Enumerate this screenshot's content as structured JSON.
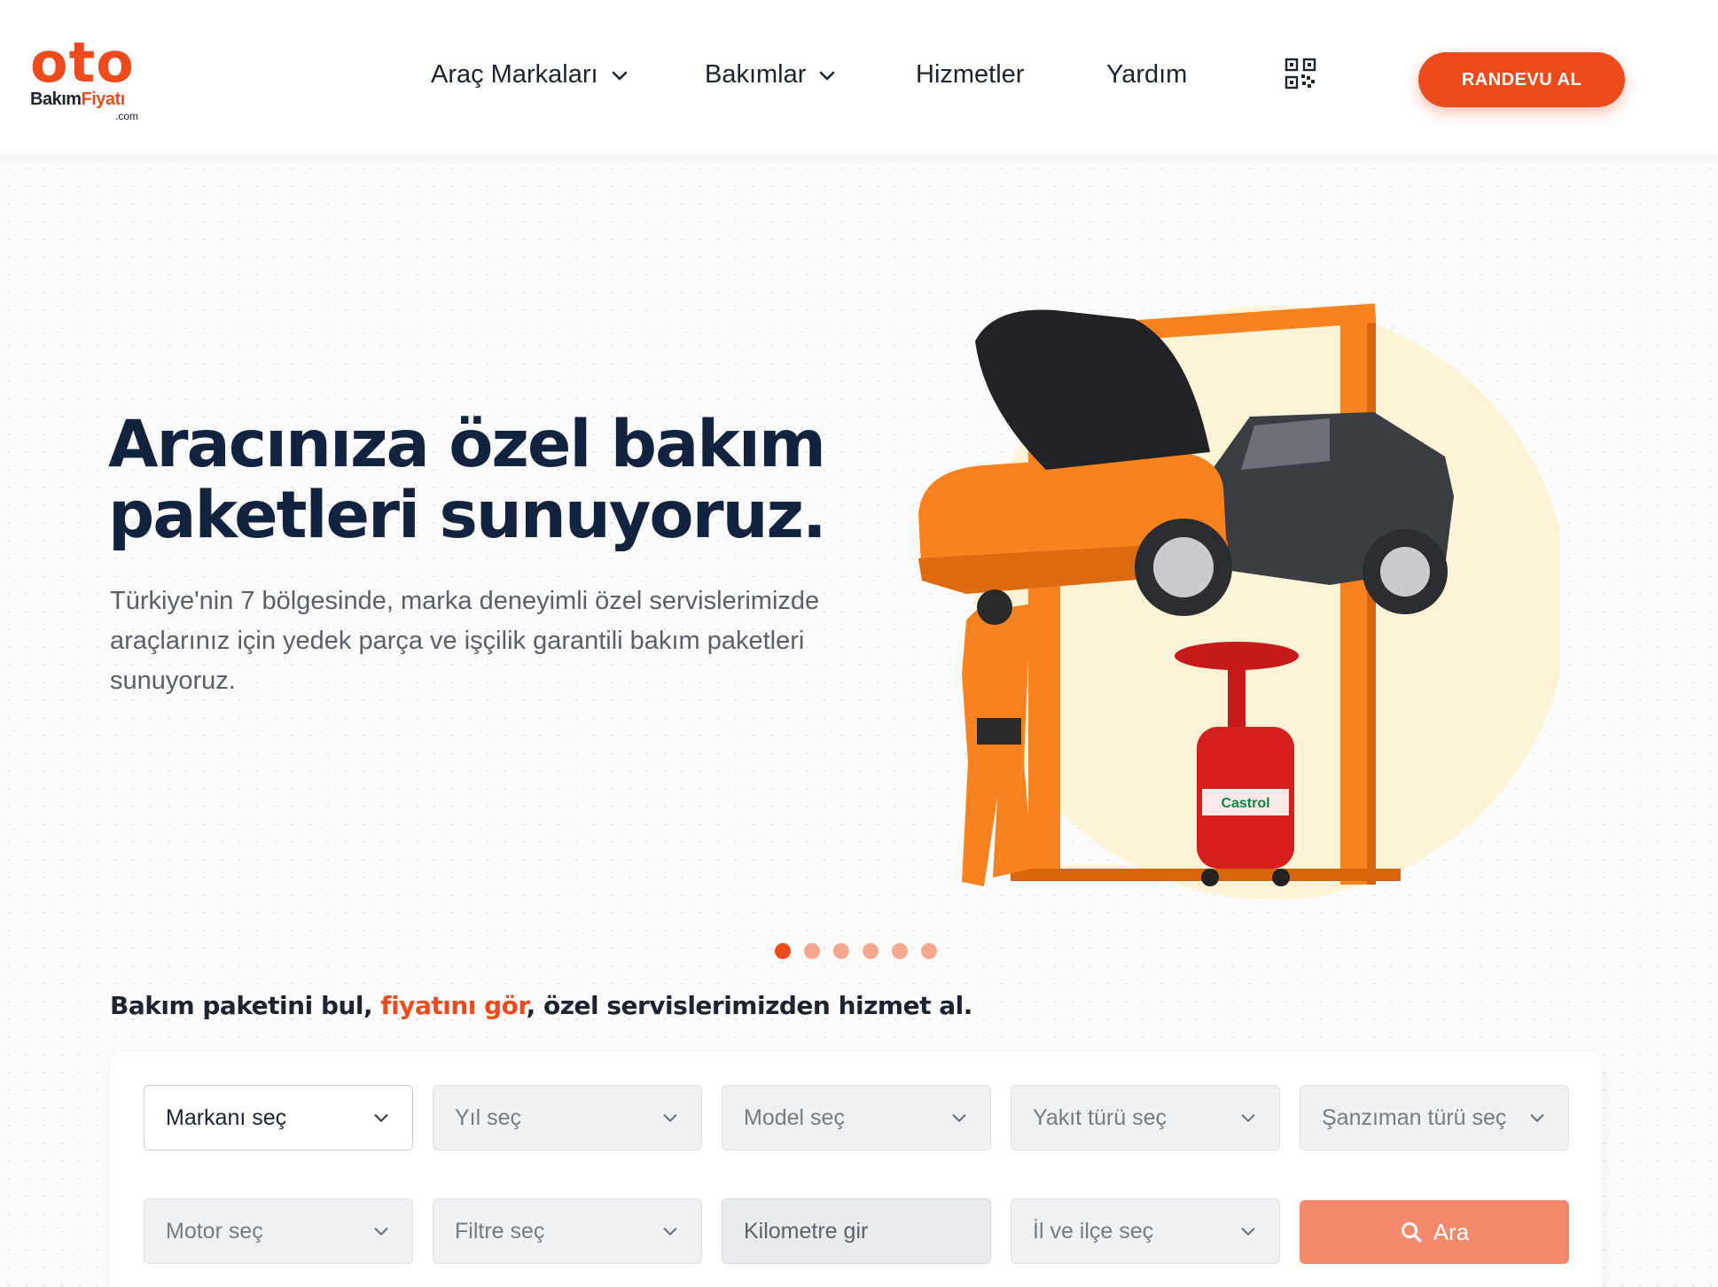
{
  "brand": {
    "logo_main": "oto",
    "logo_sub_a": "Bakım",
    "logo_sub_b": "Fiyatı",
    "logo_domain": ".com"
  },
  "nav": {
    "items": [
      {
        "label": "Araç Markaları",
        "has_dropdown": true
      },
      {
        "label": "Bakımlar",
        "has_dropdown": true
      },
      {
        "label": "Hizmetler",
        "has_dropdown": false
      },
      {
        "label": "Yardım",
        "has_dropdown": false
      }
    ],
    "qr_icon": "qr-code-icon",
    "cta_label": "RANDEVU AL"
  },
  "hero": {
    "title_line1": "Aracınıza özel bakım",
    "title_line2": "paketleri sunuyoruz.",
    "description": "Türkiye'nin 7 bölgesinde, marka deneyimli özel servislerimizde araçlarınız için yedek parça ve işçilik garantili bakım paketleri sunuyoruz.",
    "image_label": "Castrol",
    "slides_count": 6,
    "active_slide": 1
  },
  "tagline": {
    "part1": "Bakım paketini bul, ",
    "highlight": "fiyatını gör",
    "part2": ", özel servislerimizden hizmet al."
  },
  "search": {
    "brand_select": "Markanı seç",
    "year_select": "Yıl seç",
    "model_select": "Model seç",
    "fuel_select": "Yakıt türü seç",
    "gearbox_select": "Şanzıman türü seç",
    "engine_select": "Motor seç",
    "filter_select": "Filtre seç",
    "km_placeholder": "Kilometre gir",
    "location_select": "İl ve ilçe seç",
    "search_button": "Ara"
  },
  "colors": {
    "accent": "#ee4b1c",
    "accent_light": "#f48a6b",
    "heading": "#12233f",
    "hero_circle": "#fdf3d6"
  }
}
